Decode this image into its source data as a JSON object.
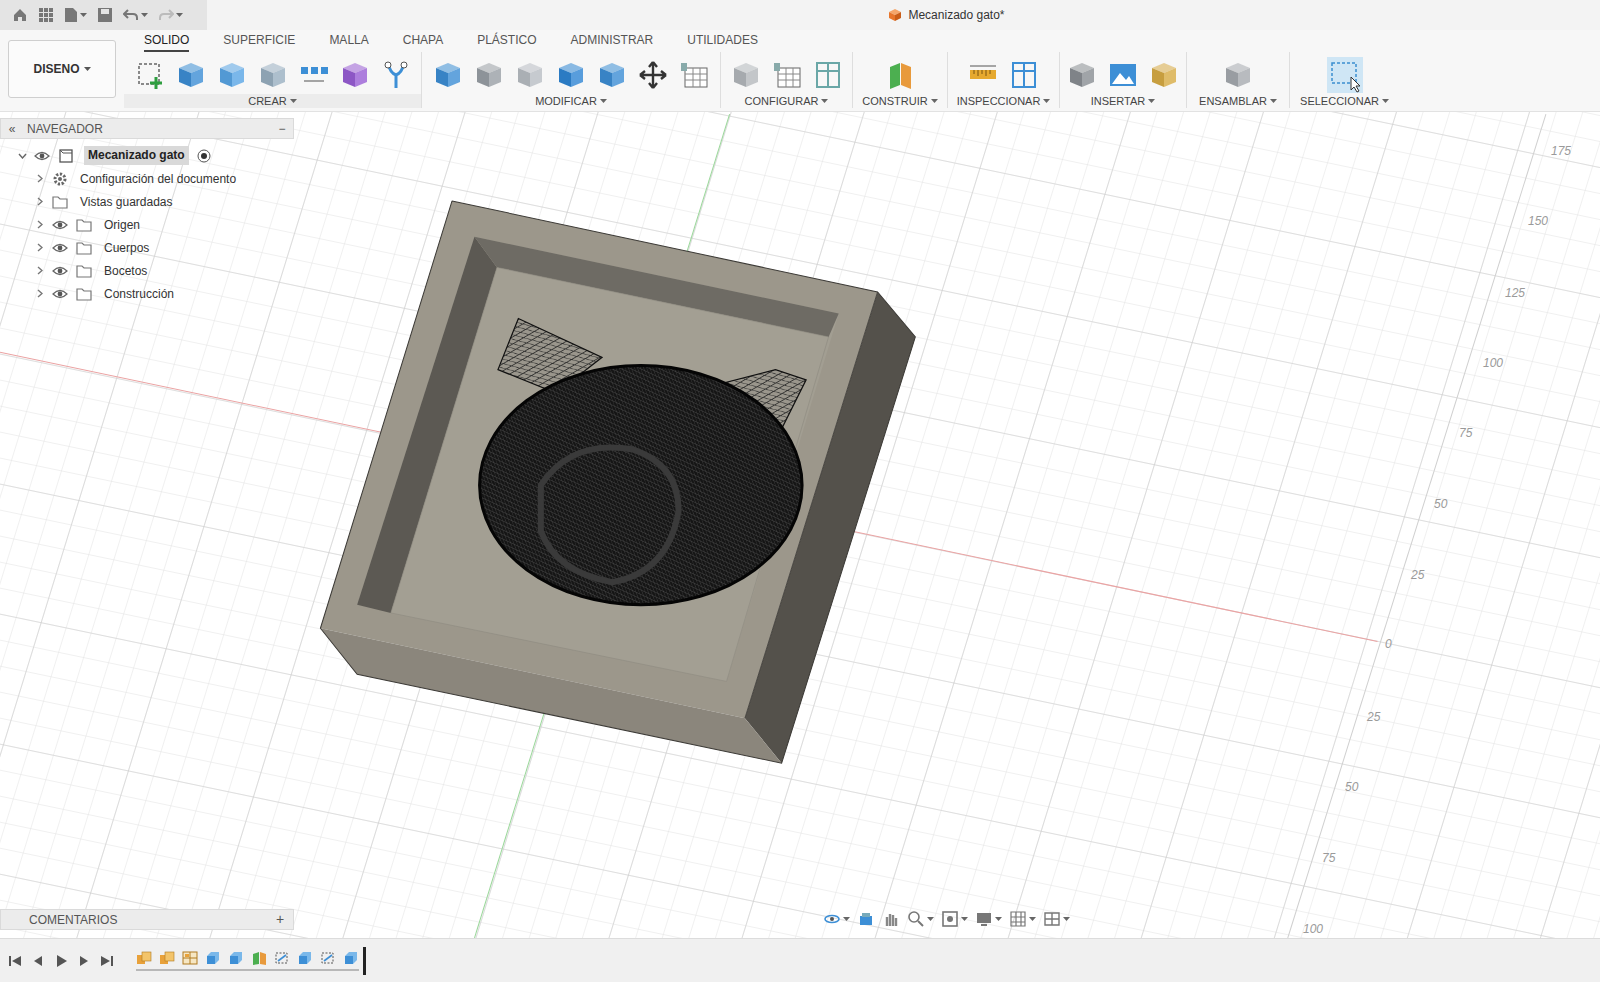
{
  "window": {
    "title": "Mecanizado gato*"
  },
  "workspace": {
    "label": "DISENO"
  },
  "tabs": [
    {
      "label": "SOLIDO",
      "selected": true
    },
    {
      "label": "SUPERFICIE",
      "selected": false
    },
    {
      "label": "MALLA",
      "selected": false
    },
    {
      "label": "CHAPA",
      "selected": false
    },
    {
      "label": "PLÁSTICO",
      "selected": false
    },
    {
      "label": "ADMINISTRAR",
      "selected": false
    },
    {
      "label": "UTILIDADES",
      "selected": false
    }
  ],
  "toolbar": {
    "groups": [
      {
        "label": "CREAR"
      },
      {
        "label": "MODIFICAR"
      },
      {
        "label": "CONFIGURAR"
      },
      {
        "label": "CONSTRUIR"
      },
      {
        "label": "INSPECCIONAR"
      },
      {
        "label": "INSERTAR"
      },
      {
        "label": "ENSAMBLAR"
      },
      {
        "label": "SELECCIONAR"
      }
    ]
  },
  "navigator": {
    "collapse": "«",
    "title": "NAVEGADOR",
    "minimize": "−",
    "items": [
      {
        "label": "Mecanizado gato",
        "kind": "component",
        "expanded": true,
        "visible": true,
        "selected": true
      },
      {
        "label": "Configuración del documento",
        "kind": "settings",
        "expanded": false,
        "visible": false,
        "selected": false
      },
      {
        "label": "Vistas guardadas",
        "kind": "views",
        "expanded": false,
        "visible": false,
        "selected": false
      },
      {
        "label": "Origen",
        "kind": "folder",
        "expanded": false,
        "visible": true,
        "selected": false
      },
      {
        "label": "Cuerpos",
        "kind": "folder",
        "expanded": false,
        "visible": true,
        "selected": false
      },
      {
        "label": "Bocetos",
        "kind": "folder",
        "expanded": false,
        "visible": true,
        "selected": false
      },
      {
        "label": "Construcción",
        "kind": "folder",
        "expanded": false,
        "visible": true,
        "selected": false
      }
    ]
  },
  "comments": {
    "title": "COMENTARIOS",
    "add": "+"
  },
  "ruler": {
    "ticks": [
      "175",
      "150",
      "125",
      "100",
      "75",
      "50",
      "25",
      "0",
      "25",
      "50",
      "75",
      "100"
    ]
  },
  "timeline": {
    "features": [
      {
        "kind": "component"
      },
      {
        "kind": "component"
      },
      {
        "kind": "mesh"
      },
      {
        "kind": "body"
      },
      {
        "kind": "body"
      },
      {
        "kind": "plane"
      },
      {
        "kind": "sketch"
      },
      {
        "kind": "body"
      },
      {
        "kind": "sketch"
      },
      {
        "kind": "body"
      }
    ]
  }
}
